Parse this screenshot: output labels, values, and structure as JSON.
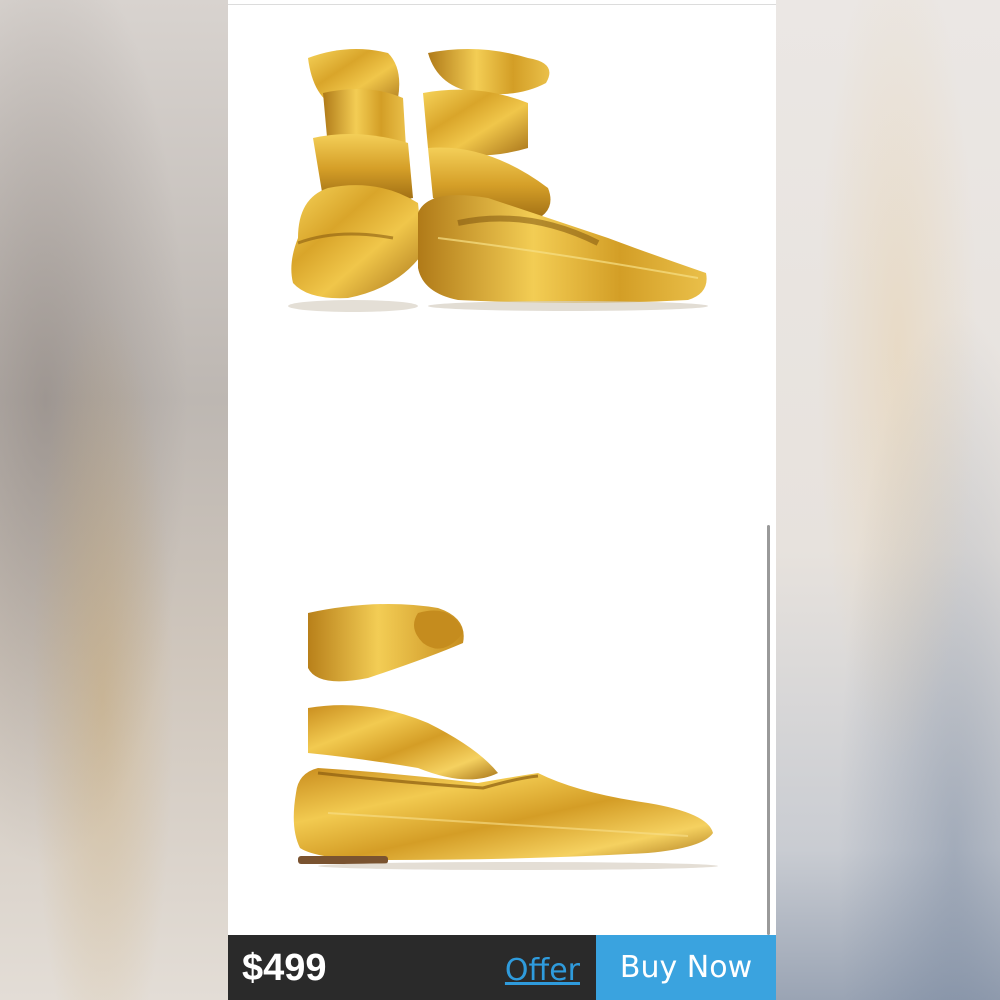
{
  "listing": {
    "price": "$499",
    "offer_label": "Offer",
    "buy_label": "Buy Now"
  },
  "colors": {
    "gold_highlight": "#f5cf52",
    "gold_mid": "#d9a52a",
    "gold_shadow": "#9b6a12",
    "bar_dark": "#2a2a2a",
    "accent_blue": "#3aa3df"
  },
  "images": {
    "top": "gold-velvet-wrap-flats-pair",
    "bottom": "gold-velvet-wrap-flat-side"
  }
}
